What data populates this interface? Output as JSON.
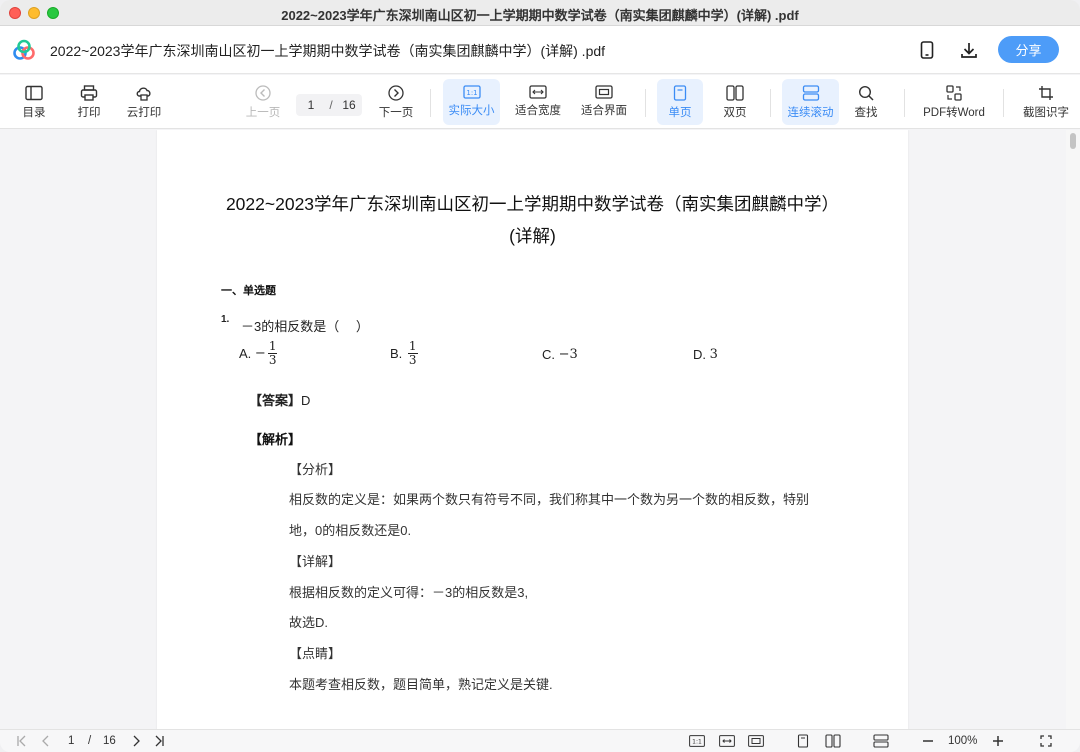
{
  "window": {
    "title": "2022~2023学年广东深圳南山区初一上学期期中数学试卷（南实集团麒麟中学）(详解) .pdf"
  },
  "header": {
    "doc_title": "2022~2023学年广东深圳南山区初一上学期期中数学试卷（南实集团麒麟中学）(详解) .pdf",
    "share_label": "分享"
  },
  "toolbar": {
    "toc": "目录",
    "print": "打印",
    "cloud_print": "云打印",
    "prev_page": "上一页",
    "current_page": "1",
    "separator": "/",
    "total_pages": "16",
    "next_page": "下一页",
    "actual_size": "实际大小",
    "actual_size_glyph": "1:1",
    "fit_width": "适合宽度",
    "fit_page": "适合界面",
    "single_page": "单页",
    "double_page": "双页",
    "continuous": "连续滚动",
    "search": "查找",
    "pdf_to_word": "PDF转Word",
    "ocr": "截图识字"
  },
  "document": {
    "title": "2022~2023学年广东深圳南山区初一上学期期中数学试卷（南实集团麒麟中学）(详解)",
    "section": "一、单选题",
    "question_number": "1.",
    "question_text": "－3的相反数是（　 ）",
    "options": [
      {
        "letter": "A.",
        "sign": "−",
        "num": "1",
        "den": "3"
      },
      {
        "letter": "B.",
        "sign": "",
        "num": "1",
        "den": "3"
      },
      {
        "letter": "C.",
        "value": "−3"
      },
      {
        "letter": "D.",
        "value": "3"
      }
    ],
    "answer_label": "【答案】",
    "answer_value": "D",
    "analysis_heading": "【解析】",
    "fenxi_label": "【分析】",
    "fenxi_line1": "相反数的定义是：如果两个数只有符号不同，我们称其中一个数为另一个数的相反数，特别",
    "fenxi_line2": "地，0的相反数还是0.",
    "xiangjie_label": "【详解】",
    "xiangjie_line1": "根据相反数的定义可得：－3的相反数是3,",
    "xiangjie_line2": "故选D.",
    "dianjing_label": "【点睛】",
    "dianjing_line": "本题考查相反数，题目简单，熟记定义是关键."
  },
  "bottombar": {
    "current_page": "1",
    "separator": "/",
    "total_pages": "16",
    "zoom": "100%",
    "actual_size_glyph": "1:1"
  },
  "colors": {
    "accent": "#3b8cf5",
    "share_button": "#4d9cf8",
    "active_bg": "#e8f1fe"
  },
  "icons": {
    "logo": "baidu-netdisk-logo",
    "phone": "phone-icon",
    "download": "download-icon"
  }
}
